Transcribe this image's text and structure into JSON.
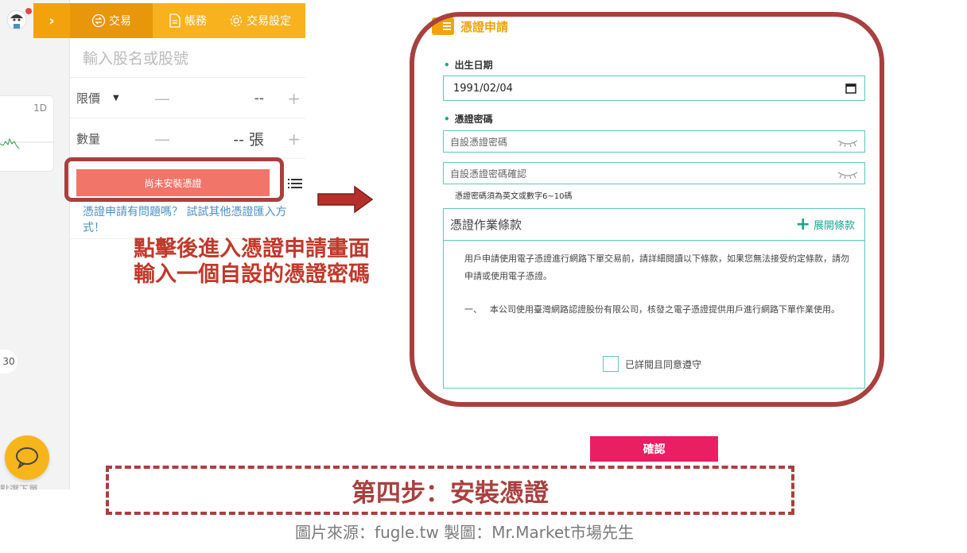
{
  "left_strip": {
    "chart_period": "1D",
    "badge_value": "30",
    "cut_text": "點選下單"
  },
  "nav": {
    "tabs": [
      {
        "label": "交易",
        "icon": "exchange-icon"
      },
      {
        "label": "帳務",
        "icon": "document-icon"
      },
      {
        "label": "交易設定",
        "icon": "gear-icon"
      }
    ],
    "expand_label": "›"
  },
  "order_panel": {
    "search_placeholder": "輸入股名或股號",
    "price_type": "限價",
    "price_value": "--",
    "quantity_label": "數量",
    "quantity_value": "-- 張",
    "install_button": "尚未安裝憑證",
    "help_link": "憑證申請有問題嗎？ 試試其他憑證匯入方式！"
  },
  "annotation": {
    "line1": "點擊後進入憑證申請畫面",
    "line2": "輸入一個自設的憑證密碼"
  },
  "form": {
    "title": "憑證申請",
    "birth_label": "出生日期",
    "birth_value": "1991/02/04",
    "password_label": "憑證密碼",
    "password_placeholder": "自設憑證密碼",
    "confirm_placeholder": "自設憑證密碼確認",
    "password_hint": "憑證密碼須為英文或數字6~10碼",
    "terms_title": "憑證作業條款",
    "terms_expand": "展開條款",
    "terms_intro": "用戶申請使用電子憑證進行網路下單交易前，請詳細閱讀以下條款，如果您無法接受約定條款，請勿申請或使用電子憑證。",
    "terms_item_num": "一、",
    "terms_item_text": "本公司使用臺灣網路認證股份有限公司，核發之電子憑證提供用戶進行網路下單作業使用。",
    "agree_label": "已詳閱且同意遵守",
    "confirm_button": "確認"
  },
  "footer": {
    "step_title": "第四步：安裝憑證",
    "credit": "圖片來源：fugle.tw  製圖：Mr.Market市場先生"
  },
  "colors": {
    "accent": "#f7b21e",
    "annotation": "#c0392b",
    "highlight_border": "#a8403f",
    "teal": "#1aa689",
    "confirm": "#e91e63"
  }
}
